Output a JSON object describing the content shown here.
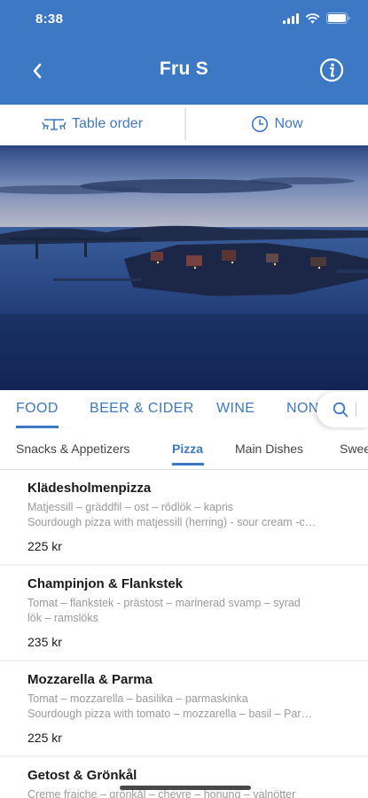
{
  "status_bar": {
    "time": "8:38"
  },
  "header": {
    "title": "Fru S",
    "back_icon": "chevron-left-icon",
    "info_icon": "info-icon"
  },
  "order_bar": {
    "table_label": "Table order",
    "time_label": "Now"
  },
  "categories": {
    "items": [
      "FOOD",
      "BEER & CIDER",
      "WINE",
      "NON"
    ],
    "active": "FOOD"
  },
  "subcategories": {
    "items": [
      "Snacks & Appetizers",
      "Pizza",
      "Main Dishes",
      "Swee"
    ],
    "active": "Pizza"
  },
  "menu_items": [
    {
      "name": "Klädesholmenpizza",
      "desc_1": "Matjessill – gräddfil – ost – rödlök – kapris",
      "desc_2": "Sourdough pizza with matjessill (herring) - sour cream -c…",
      "price": "225 kr"
    },
    {
      "name": "Champinjon & Flankstek",
      "desc_1": "Tomat – flankstek - prästost – marinerad svamp – syrad",
      "desc_2": "lök – ramslöks",
      "price": "235 kr"
    },
    {
      "name": "Mozzarella & Parma",
      "desc_1": "Tomat – mozzarella – basilika – parmaskinka",
      "desc_2": "Sourdough pizza with tomato – mozzarella – basil – Par…",
      "price": "225 kr"
    },
    {
      "name": "Getost & Grönkål",
      "desc_1": "Creme fraiche – grönkål – chevre – honung – valnötter",
      "desc_2": "",
      "price": ""
    }
  ],
  "colors": {
    "accent": "#3d78c4",
    "background": "#ffffff",
    "muted_text": "#9a9a9a"
  }
}
